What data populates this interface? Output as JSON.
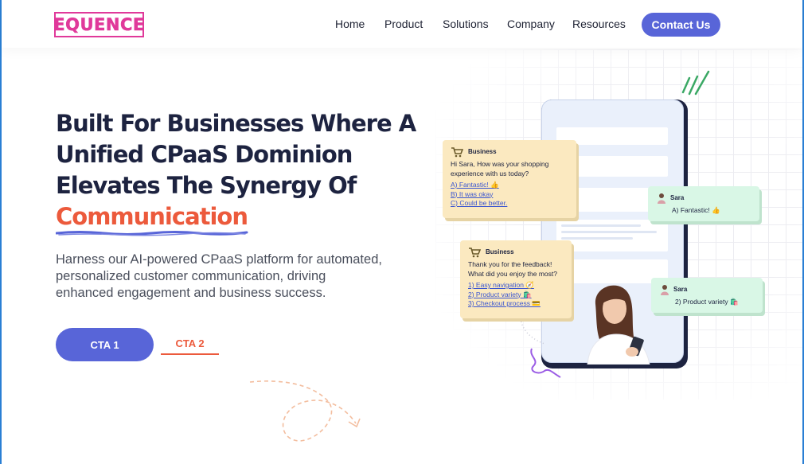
{
  "brand": {
    "logo_text": "EQUENCE",
    "logo_color": "#e0399a"
  },
  "nav": {
    "items": [
      "Home",
      "Product",
      "Solutions",
      "Company",
      "Resources"
    ],
    "cta_label": "Contact Us"
  },
  "hero": {
    "headline_lines": [
      "Built For Businesses Where A",
      "Unified CPaaS Dominion",
      "Elevates The Synergy Of"
    ],
    "headline_accent": "Communication",
    "subtext_lines": [
      "Harness our AI-powered CPaaS platform for automated,",
      "personalized customer communication, driving",
      "enhanced engagement and business success."
    ],
    "cta1_label": "CTA 1",
    "cta2_label": "CTA 2"
  },
  "chat": {
    "business1": {
      "sender": "Business",
      "message": "Hi Sara, How was your shopping experience with us today?",
      "options": [
        "A) Fantastic! 👍",
        "B) It was okay",
        "C) Could be better."
      ]
    },
    "sara1": {
      "sender": "Sara",
      "message": "A) Fantastic! 👍"
    },
    "business2": {
      "sender": "Business",
      "message": "Thank you for the feedback! What did you enjoy the most?",
      "options": [
        "1) Easy navigation 🧭",
        "2) Product variety 🛍️",
        "3) Checkout process 💳"
      ]
    },
    "sara2": {
      "sender": "Sara",
      "message": "2) Product variety 🛍️"
    }
  },
  "colors": {
    "primary": "#5865d8",
    "accent": "#ec5a3c",
    "heading": "#1d2340",
    "business_bubble": "#fbe9c0",
    "customer_bubble": "#d9f7e6"
  },
  "icons": [
    "cart-icon",
    "user-avatar-icon",
    "sparkle-icon",
    "dashed-arrow-icon"
  ]
}
